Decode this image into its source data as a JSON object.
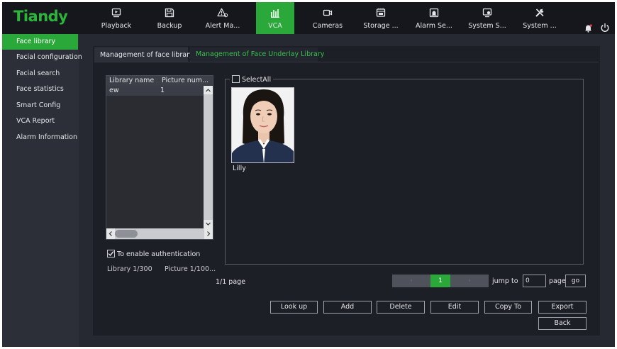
{
  "app": {
    "logo": "Tiandy"
  },
  "nav": {
    "tabs": [
      {
        "label": "Playback",
        "icon": "playback-icon"
      },
      {
        "label": "Backup",
        "icon": "backup-icon"
      },
      {
        "label": "Alert Ma...",
        "icon": "alert-icon"
      },
      {
        "label": "VCA",
        "icon": "vca-icon",
        "active": true
      },
      {
        "label": "Cameras",
        "icon": "camera-icon"
      },
      {
        "label": "Storage ...",
        "icon": "storage-icon"
      },
      {
        "label": "Alarm Se...",
        "icon": "alarm-icon"
      },
      {
        "label": "System S...",
        "icon": "system-status-icon"
      },
      {
        "label": "System ...",
        "icon": "tools-icon"
      }
    ]
  },
  "sidebar": {
    "items": [
      {
        "label": "Face library",
        "active": true
      },
      {
        "label": "Facial configuration"
      },
      {
        "label": "Facial search"
      },
      {
        "label": "Face statistics"
      },
      {
        "label": "Smart Config"
      },
      {
        "label": "VCA Report"
      },
      {
        "label": "Alarm Information"
      }
    ]
  },
  "tabs": {
    "management": "Management of face library",
    "underlay": "Management of Face Underlay Library"
  },
  "library_table": {
    "columns": [
      "Library name",
      "Picture num..."
    ],
    "rows": [
      {
        "name": "ew",
        "count": "1"
      }
    ]
  },
  "auth": {
    "label": "To enable authentication",
    "checked": true
  },
  "counts": {
    "library": "Library 1/300",
    "picture": "Picture 1/100..."
  },
  "pictures": {
    "select_all": "SelectAll",
    "items": [
      {
        "name": "Lilly"
      }
    ]
  },
  "pagination": {
    "info": "1/1 page",
    "current": "1",
    "prev": "‹",
    "next": "›",
    "jump_label": "jump to",
    "jump_value": "0",
    "page_label": "page",
    "go": "go"
  },
  "buttons": {
    "lookup": "Look up",
    "add": "Add",
    "delete": "Delete",
    "edit": "Edit",
    "copy_to": "Copy To",
    "export": "Export",
    "back": "Back"
  },
  "colors": {
    "accent": "#2aa83a",
    "background": "#262932",
    "topbar": "#15171c"
  }
}
